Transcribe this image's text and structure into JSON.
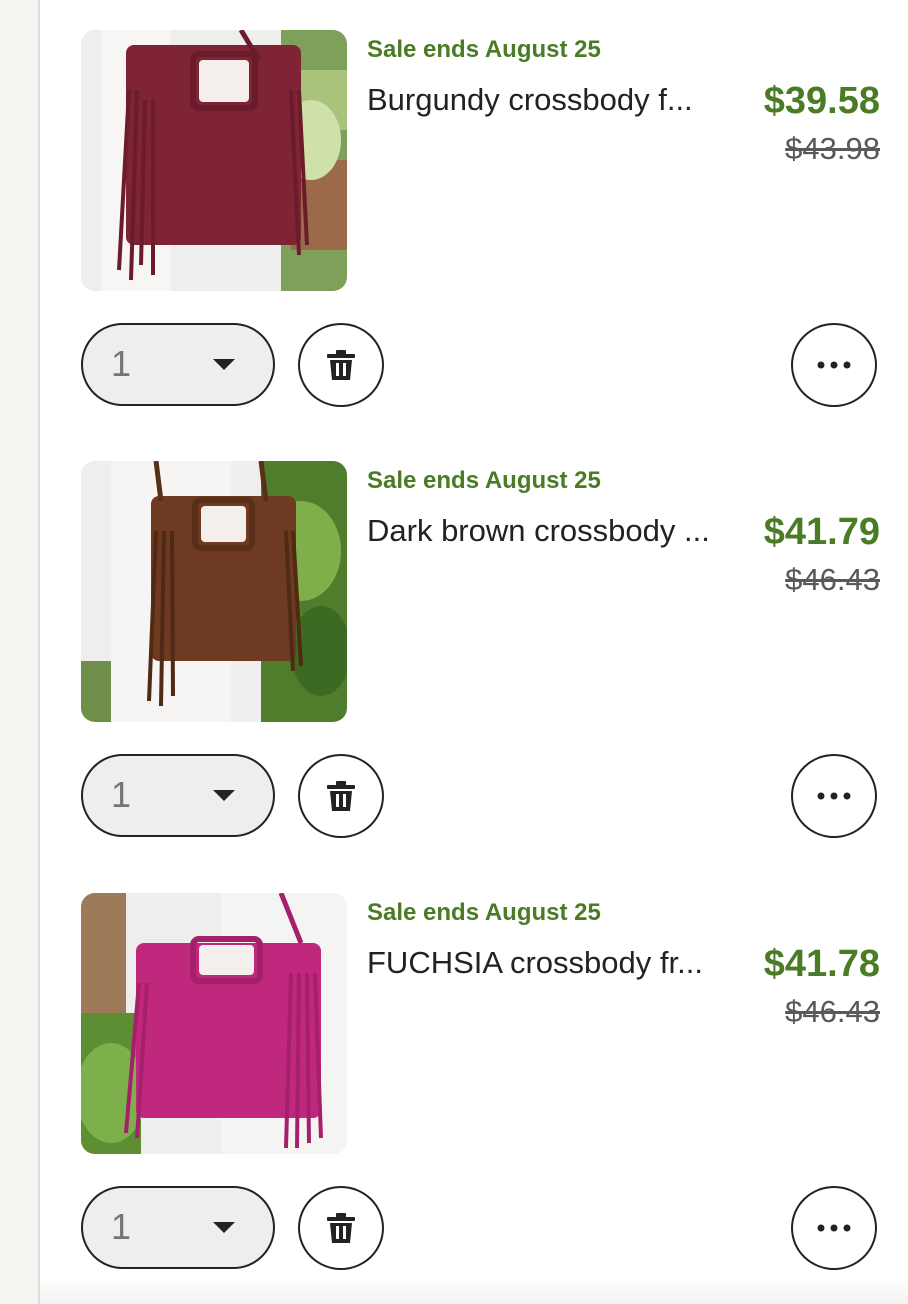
{
  "cart": {
    "items": [
      {
        "sale_text": "Sale ends August 25",
        "title": "Burgundy crossbody f...",
        "price": "$39.58",
        "original_price": "$43.98",
        "quantity": "1",
        "image_icon": "burgundy-fringe-bag-photo",
        "bag_color": "#7e2434"
      },
      {
        "sale_text": "Sale ends August 25",
        "title": "Dark brown crossbody ...",
        "price": "$41.79",
        "original_price": "$46.43",
        "quantity": "1",
        "image_icon": "dark-brown-fringe-bag-photo",
        "bag_color": "#6e3b22"
      },
      {
        "sale_text": "Sale ends August 25",
        "title": "FUCHSIA crossbody fr...",
        "price": "$41.78",
        "original_price": "$46.43",
        "quantity": "1",
        "image_icon": "fuchsia-fringe-bag-photo",
        "bag_color": "#c0287e"
      }
    ]
  },
  "colors": {
    "sale_green": "#4a7b25",
    "text_dark": "#222222",
    "strike_gray": "#595959"
  },
  "icons": {
    "delete": "trash-icon",
    "more": "more-options-icon",
    "dropdown": "chevron-down-icon"
  }
}
